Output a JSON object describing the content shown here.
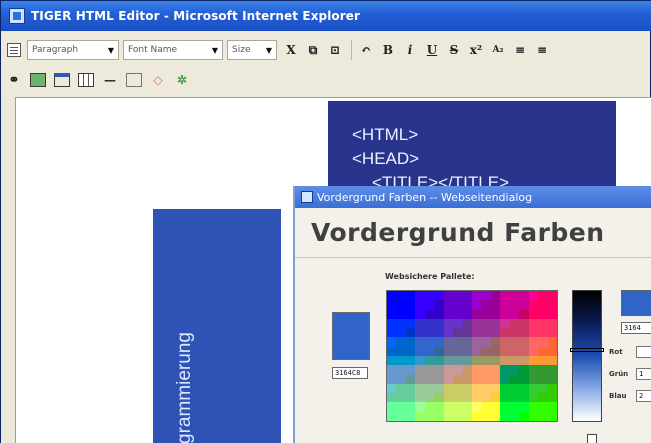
{
  "window": {
    "title": "TIGER HTML Editor - Microsoft Internet Explorer"
  },
  "toolbar": {
    "paragraph": "Paragraph",
    "font_name": "Font Name",
    "size": "Size",
    "buttons": {
      "cut": "X",
      "bold": "B",
      "italic": "i",
      "underline": "U",
      "strike": "S",
      "superscript": "x²",
      "subscript": "A₂"
    },
    "icons": [
      "editor-icon",
      "cut-icon",
      "copy-icon",
      "paste-icon",
      "undo-icon",
      "bold-icon",
      "italic-icon",
      "underline-icon",
      "strike-icon",
      "superscript-icon",
      "subscript-icon",
      "align-left-icon",
      "align-center-icon",
      "link-icon",
      "image-icon",
      "table-icon",
      "insert-table-icon",
      "horizontal-rule-icon",
      "form-icon",
      "anchor-icon",
      "special-icon"
    ]
  },
  "editor": {
    "code_lines": [
      "<HTML>",
      "<HEAD>",
      "<TITLE></TITLE>"
    ],
    "side_text": "grammierung",
    "colors": {
      "code_panel": "#29358c",
      "side_panel": "#2f52b5"
    }
  },
  "dialog": {
    "title": "Vordergrund Farben -- Webseitendialog",
    "header": "Vordergrund Farben",
    "palette_label": "Websichere Pallete:",
    "current_hex": "3164C8",
    "preview_hex": "3164",
    "rgb": {
      "red_label": "Rot",
      "green_label": "Grün",
      "blue_label": "Blau",
      "red_value": "",
      "green_value": "1",
      "blue_value": "2"
    },
    "selected_color": "#3164c8"
  }
}
